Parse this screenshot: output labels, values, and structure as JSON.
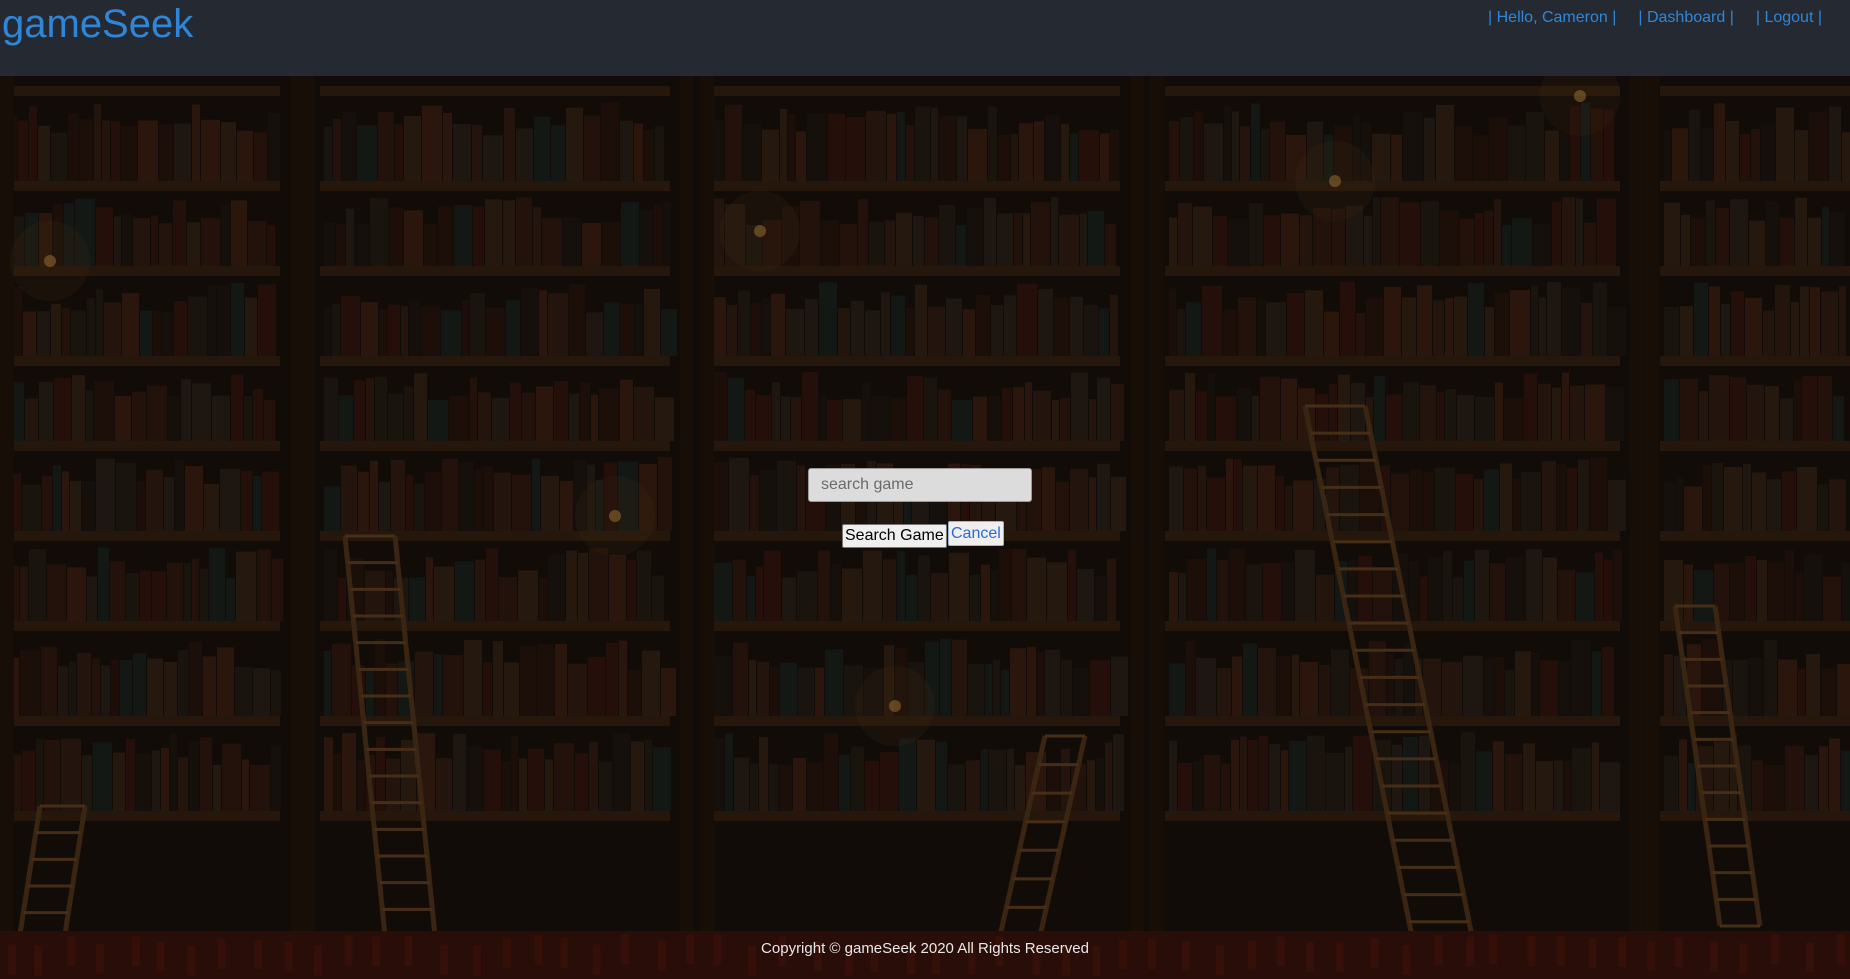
{
  "header": {
    "brand": "gameSeek",
    "nav": {
      "greeting": "| Hello, Cameron |",
      "dashboard": "| Dashboard |",
      "logout": "| Logout |"
    }
  },
  "search": {
    "placeholder": "search game",
    "value": "",
    "submit_label": "Search Game",
    "cancel_label": "Cancel"
  },
  "footer": {
    "copyright": "Copyright © gameSeek 2020 All Rights Reserved"
  },
  "colors": {
    "header_bg": "#252a32",
    "link": "#2f86d8",
    "background": "#1e140e"
  }
}
